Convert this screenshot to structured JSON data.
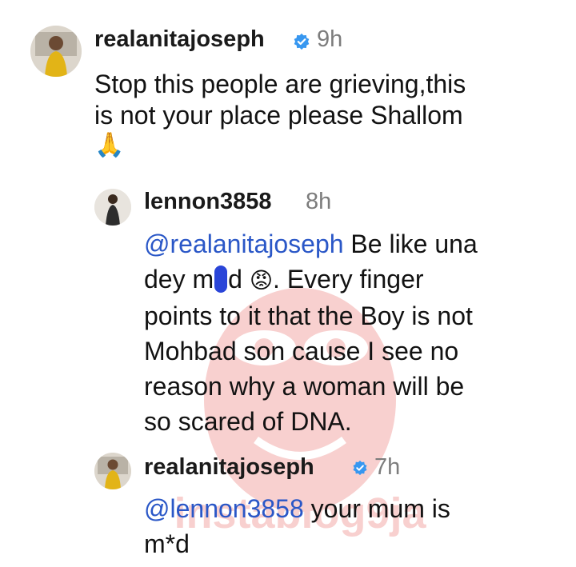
{
  "comments": [
    {
      "handle": "realanitajoseph",
      "verified": true,
      "time": "9h",
      "line1": "Stop this people are grieving,this",
      "line2": "is not your place please Shallom",
      "emoji": "🙏",
      "emoji_name": "praying-hands-icon"
    },
    {
      "handle": "lennon3858",
      "verified": false,
      "time": "8h",
      "mention": "@realanitajoseph",
      "line1_rest": " Be like una",
      "line2_pre": "dey m",
      "line2_post": "d",
      "line2_emoji": "😡",
      "line2_rest": ". Every finger",
      "line3": "points to it that the Boy is not",
      "line4": "Mohbad son cause I see no",
      "line5": "reason why a woman will be",
      "line6": "so scared of DNA."
    },
    {
      "handle": "realanitajoseph",
      "verified": true,
      "time": "7h",
      "mention": "@lennon3858",
      "line1_rest": " your mum is",
      "line2": "m*d"
    }
  ],
  "watermark_text": "instablog9ja",
  "colors": {
    "mention": "#2a57c7",
    "verified": "#3797f0",
    "timestamp": "#7c7c7c",
    "watermark": "#e0302a"
  }
}
